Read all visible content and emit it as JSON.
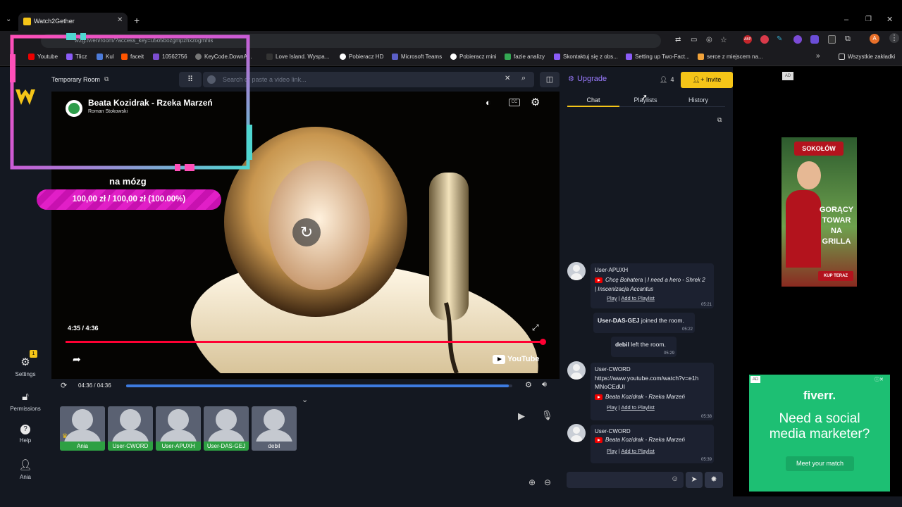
{
  "browser": {
    "tab_title": "Watch2Gether",
    "new_tab": "+",
    "url": "w2g.tv/en/room/?access_key=u5o5bozgmpzhxzogmhis",
    "bookmarks": [
      "Youtube",
      "Tlicz",
      "Kul",
      "faceit",
      "10562756",
      "KeyCode.DownA...",
      "Love Island. Wyspa...",
      "Pobieracz HD",
      "Microsoft Teams",
      "Pobieracz mini",
      "fazie analizy",
      "Skontaktuj się z obs...",
      "Setting up Two-Fact...",
      "serce z miejscem na...",
      "Wszystkie zakładki"
    ],
    "bookmarks_more": "»",
    "profile_initial": "A",
    "adblock": "ABP"
  },
  "room": {
    "name": "Temporary Room",
    "search_placeholder": "Search or paste a video link..."
  },
  "video": {
    "title": "Beata Kozidrak - Rzeka Marzeń",
    "channel": "Roman Stokowski",
    "time_overlay": "4:35 / 4:36",
    "progress": 0.996,
    "youtube_logo": "YouTube"
  },
  "overlay": {
    "label": "na mózg",
    "goal": "100,00 zł / 100,00 zł (100.00%)"
  },
  "player": {
    "time": "04:36 / 04:36",
    "progress": 0.99
  },
  "nav": {
    "settings": "Settings",
    "settings_badge": "1",
    "permissions": "Permissions",
    "help": "Help",
    "user": "Ania"
  },
  "header": {
    "upgrade": "Upgrade",
    "users_count": "4",
    "invite": "Invite"
  },
  "tabs": [
    "Chat",
    "Playlists",
    "History"
  ],
  "chat": {
    "messages": [
      {
        "user": "User-APUXH",
        "title": "Chcę Bohatera | I need a hero - Shrek 2 | Inscenizacja Accantus",
        "play": "Play",
        "sep": "|",
        "add": "Add to Playlist",
        "time": "05:21"
      },
      {
        "bold": "User-DAS-GEJ",
        "text": " joined the room.",
        "time": "05:22"
      },
      {
        "bold": "debil",
        "text": " left the room.",
        "time": "05:29"
      },
      {
        "user": "User-CWORD",
        "url": "https://www.youtube.com/watch?v=e1hMNoCEdUI",
        "title": "Beata Kozidrak - Rzeka Marzeń",
        "play": "Play",
        "sep": "|",
        "add": "Add to Playlist",
        "time": "05:38"
      },
      {
        "user": "User-CWORD",
        "title": "Beata Kozidrak - Rzeka Marzeń",
        "play": "Play",
        "sep": "|",
        "add": "Add to Playlist",
        "time": "05:39"
      }
    ]
  },
  "cams": [
    "Ania",
    "User-CWORD",
    "User-APUXH",
    "User-DAS-GEJ",
    "debil"
  ],
  "ads": {
    "ad_label": "AD",
    "sokolow_brand": "SOKOŁÓW",
    "sokolow_headline": "GORĄCY TOWAR NA GRILLA",
    "sokolow_cta": "KUP TERAZ",
    "fiverr_brand": "fiverr.",
    "fiverr_headline": "Need a social media marketer?",
    "fiverr_cta": "Meet your match"
  },
  "colors": {
    "accent": "#f5c518",
    "upgrade": "#9b7bff",
    "progress_red": "#ff0033",
    "goal_pink": "#e11fc7",
    "player_blue": "#3d7be0"
  }
}
